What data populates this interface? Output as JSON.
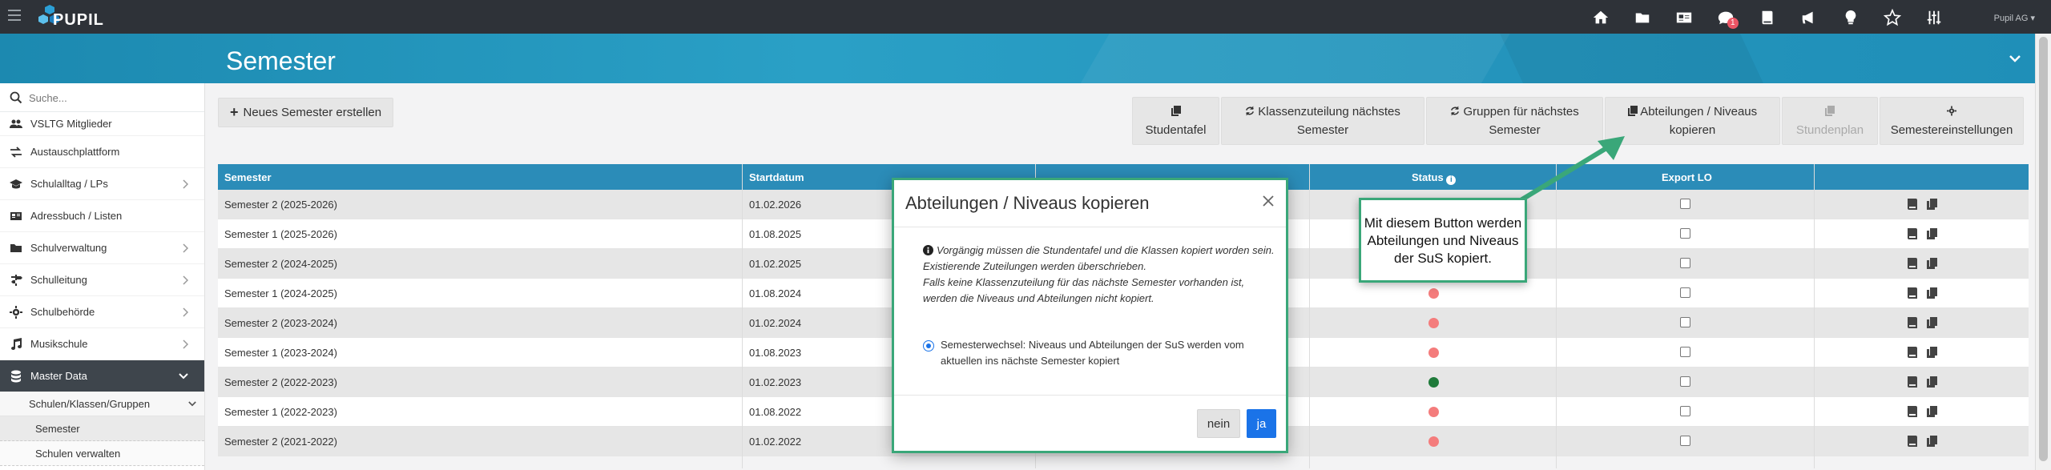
{
  "app": {
    "logo_text": "PUPIL",
    "user_label": "Pupil AG"
  },
  "topbar": {
    "icons": [
      "home-icon",
      "folder-icon",
      "address-card-icon",
      "chat-icon",
      "book-icon",
      "megaphone-icon",
      "lightbulb-icon",
      "star-icon",
      "sliders-icon"
    ],
    "chat_badge": "1"
  },
  "page": {
    "title": "Semester"
  },
  "sidebar": {
    "search_placeholder": "Suche...",
    "items": [
      {
        "label": "VSLTG Mitglieder",
        "icon": "users-icon"
      },
      {
        "label": "Austauschplattform",
        "icon": "exchange-icon"
      },
      {
        "label": "Schulalltag / LPs",
        "icon": "graduation-cap-icon"
      },
      {
        "label": "Adressbuch / Listen",
        "icon": "address-book-icon"
      },
      {
        "label": "Schulverwaltung",
        "icon": "folder-icon"
      },
      {
        "label": "Schulleitung",
        "icon": "signpost-icon"
      },
      {
        "label": "Schulbehörde",
        "icon": "cog-icon"
      },
      {
        "label": "Musikschule",
        "icon": "music-icon"
      },
      {
        "label": "Master Data",
        "icon": "database-icon"
      }
    ],
    "sub_item": "Schulen/Klassen/Gruppen",
    "subsub_items": [
      "Semester",
      "Schulen verwalten"
    ]
  },
  "toolbar": {
    "new_semester": "Neues Semester erstellen",
    "buttons": [
      {
        "line1": "",
        "line2": "Studentafel"
      },
      {
        "line1": "Klassenzuteilung nächstes",
        "line2": "Semester"
      },
      {
        "line1": "Gruppen für nächstes",
        "line2": "Semester"
      },
      {
        "line1": "Abteilungen / Niveaus",
        "line2": "kopieren"
      },
      {
        "line1": "",
        "line2": "Stundenplan"
      },
      {
        "line1": "",
        "line2": "Semestereinstellungen"
      }
    ]
  },
  "table": {
    "headers": {
      "semester": "Semester",
      "startdatum": "Startdatum",
      "status": "Status",
      "export": "Export LO"
    },
    "rows": [
      {
        "semester": "Semester 2 (2025-2026)",
        "start": "01.02.2026",
        "status": ""
      },
      {
        "semester": "Semester 1 (2025-2026)",
        "start": "01.08.2025",
        "status": ""
      },
      {
        "semester": "Semester 2 (2024-2025)",
        "start": "01.02.2025",
        "status": ""
      },
      {
        "semester": "Semester 1 (2024-2025)",
        "start": "01.08.2024",
        "status": "red"
      },
      {
        "semester": "Semester 2 (2023-2024)",
        "start": "01.02.2024",
        "status": "red"
      },
      {
        "semester": "Semester 1 (2023-2024)",
        "start": "01.08.2023",
        "status": "red"
      },
      {
        "semester": "Semester 2 (2022-2023)",
        "start": "01.02.2023",
        "status": "green"
      },
      {
        "semester": "Semester 1 (2022-2023)",
        "start": "01.08.2022",
        "status": "red"
      },
      {
        "semester": "Semester 2 (2021-2022)",
        "start": "01.02.2022",
        "status": "red"
      }
    ],
    "colors": {
      "red": "#f47c7c",
      "green": "#1f7a3a"
    }
  },
  "modal": {
    "title": "Abteilungen / Niveaus kopieren",
    "info_lines": [
      "Vorgängig müssen die Stundentafel und die Klassen kopiert worden sein.",
      "Existierende Zuteilungen werden überschrieben.",
      "Falls keine Klassenzuteilung für das nächste Semester vorhanden ist, werden die Niveaus und Abteilungen nicht kopiert."
    ],
    "radio_label": "Semesterwechsel: Niveaus und Abteilungen der SuS werden vom aktuellen ins nächste Semester kopiert",
    "btn_no": "nein",
    "btn_yes": "ja"
  },
  "callout": {
    "text": "Mit diesem Button werden Abteilungen und Niveaus der SuS kopiert."
  }
}
